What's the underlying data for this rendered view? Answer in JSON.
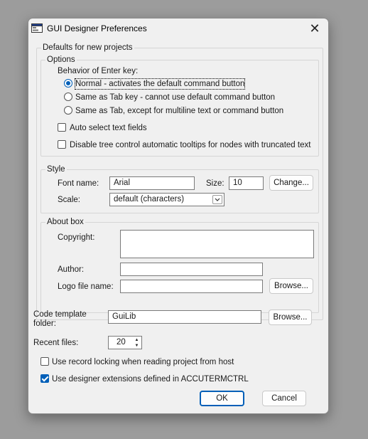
{
  "window": {
    "title": "GUI Designer Preferences",
    "close_glyph": "✕"
  },
  "defaults": {
    "legend": "Defaults for new projects",
    "options": {
      "legend": "Options",
      "enter_key_label": "Behavior of Enter key:",
      "radios": [
        {
          "label": "Normal - activates the default command button",
          "checked": true
        },
        {
          "label": "Same as Tab key - cannot use default command button",
          "checked": false
        },
        {
          "label": "Same as Tab, except for multiline text or command button",
          "checked": false
        }
      ],
      "auto_select": {
        "label": "Auto select text fields",
        "checked": false
      },
      "disable_tooltips": {
        "label": "Disable tree control automatic tooltips for nodes with truncated text",
        "checked": false
      }
    },
    "style": {
      "legend": "Style",
      "font_name_label": "Font name:",
      "font_name_value": "Arial",
      "size_label": "Size:",
      "size_value": "10",
      "change_button": "Change...",
      "scale_label": "Scale:",
      "scale_value": "default (characters)"
    },
    "about": {
      "legend": "About box",
      "copyright_label": "Copyright:",
      "copyright_value": "",
      "author_label": "Author:",
      "author_value": "",
      "logo_label": "Logo file name:",
      "logo_value": "",
      "browse_button": "Browse..."
    }
  },
  "code_template": {
    "label": "Code template folder:",
    "value": "GuiLib",
    "browse_button": "Browse..."
  },
  "recent_files": {
    "label": "Recent files:",
    "value": "20"
  },
  "record_locking": {
    "label": "Use record locking when reading project from host",
    "checked": false
  },
  "designer_ext": {
    "label": "Use designer extensions defined in ACCUTERMCTRL",
    "checked": true
  },
  "footer": {
    "ok": "OK",
    "cancel": "Cancel"
  },
  "colors": {
    "accent": "#005fb8",
    "dialog_bg": "#f0f0f0",
    "backdrop": "#9c9c9c"
  },
  "icons": {
    "app": "window-app-icon",
    "close": "close-icon",
    "combo": "chevron-down-icon",
    "spin_up": "caret-up-icon",
    "spin_down": "caret-down-icon"
  }
}
